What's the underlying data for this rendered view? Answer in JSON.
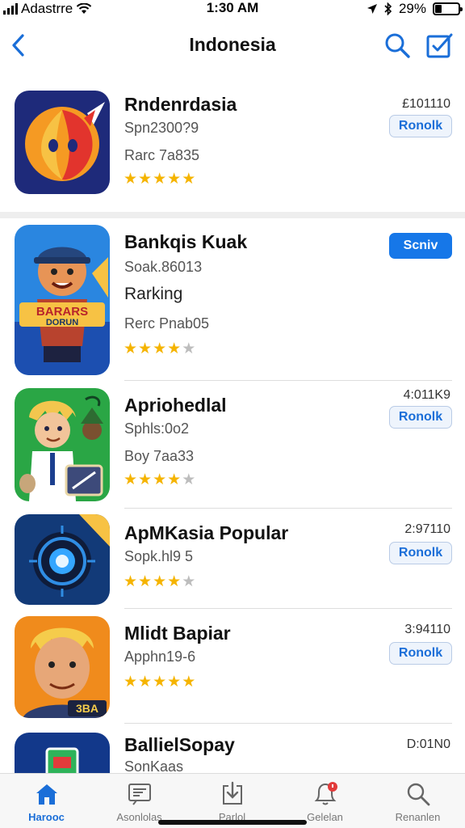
{
  "status_bar": {
    "carrier": "Adastrre",
    "time": "1:30 AM",
    "battery_percent": "29%",
    "battery_level": 0.29
  },
  "nav": {
    "title": "Indonesia",
    "icons": [
      "back-chevron-icon",
      "search-icon",
      "compose-icon"
    ]
  },
  "colors": {
    "accent": "#1677e8",
    "star": "#f5b400",
    "star_off": "#bdbdbd"
  },
  "apps": [
    {
      "name": "Rndenrdasia",
      "sub": "Spn2300?9",
      "extra": "Rarc 7a835",
      "rating": 5,
      "price": "£101110",
      "button": "Ronolk",
      "button_primary": false
    },
    {
      "name": "Bankqis Kuak",
      "sub": "Soak.86013",
      "extra": "Rarking",
      "extra2": "Rerc Pnab05",
      "rating": 4,
      "price": "",
      "button": "Scniv",
      "button_primary": true,
      "icon_text_1": "BARARS",
      "icon_text_2": "DORUN"
    },
    {
      "name": "Apriohedlal",
      "sub": "Sphls:0o2",
      "extra": "Boy 7aa33",
      "rating": 4,
      "price": "4:011K9",
      "button": "Ronolk",
      "button_primary": false
    },
    {
      "name": "ApMKasia Popular",
      "sub": "Sopk.hl9 5",
      "rating": 4,
      "price": "2:97110",
      "button": "Ronolk",
      "button_primary": false
    },
    {
      "name": "Mlidt Bapiar",
      "sub": "Apphn19-6",
      "rating": 5,
      "price": "3:94110",
      "button": "Ronolk",
      "button_primary": false,
      "icon_text_1": "3BA"
    },
    {
      "name": "BallielSopay",
      "sub": "SonKaas",
      "rating": 0,
      "price": "D:01N0",
      "button": "",
      "button_primary": false
    }
  ],
  "tabs": [
    {
      "label": "Harooc",
      "icon": "home-icon",
      "active": true
    },
    {
      "label": "Asonlolas",
      "icon": "news-icon",
      "active": false
    },
    {
      "label": "Parlol",
      "icon": "download-icon",
      "active": false
    },
    {
      "label": "Gelelan",
      "icon": "notification-icon",
      "active": false
    },
    {
      "label": "Renanlen",
      "icon": "search-icon",
      "active": false
    }
  ]
}
